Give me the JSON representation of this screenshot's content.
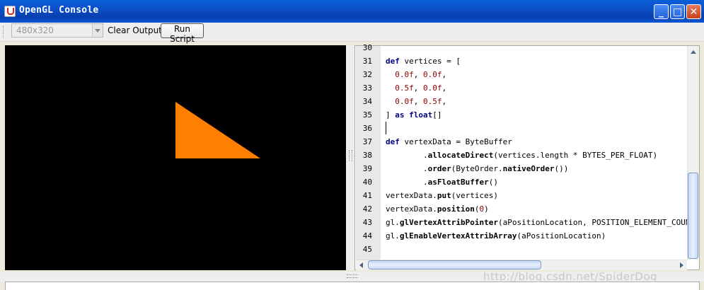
{
  "window": {
    "title": "OpenGL Console",
    "buttons": {
      "minimize": "_",
      "maximize": "□",
      "close": "✕"
    }
  },
  "toolbar": {
    "resolution_value": "480x320",
    "clear_label": "Clear Output",
    "run_label": "Run Script"
  },
  "canvas": {
    "background_color": "#000000",
    "shape": "triangle",
    "shape_color": "#ff7f00"
  },
  "editor": {
    "line_numbers": [
      "30",
      "31",
      "32",
      "33",
      "34",
      "35",
      "36",
      "37",
      "38",
      "39",
      "40",
      "41",
      "42",
      "43",
      "44",
      "45"
    ],
    "lines": [
      "",
      "def vertices = [",
      "  0.0f, 0.0f,",
      "  0.5f, 0.0f,",
      "  0.0f, 0.5f,",
      "] as float[]",
      "",
      "def vertexData = ByteBuffer",
      "        .allocateDirect(vertices.length * BYTES_PER_FLOAT)",
      "        .order(ByteOrder.nativeOrder())",
      "        .asFloatBuffer()",
      "vertexData.put(vertices)",
      "vertexData.position(0)",
      "gl.glVertexAttribPointer(aPositionLocation, POSITION_ELEMENT_COUNT,",
      "gl.glEnableVertexAttribArray(aPositionLocation)",
      ""
    ]
  },
  "watermark": "http://blog.csdn.net/SpiderDog"
}
